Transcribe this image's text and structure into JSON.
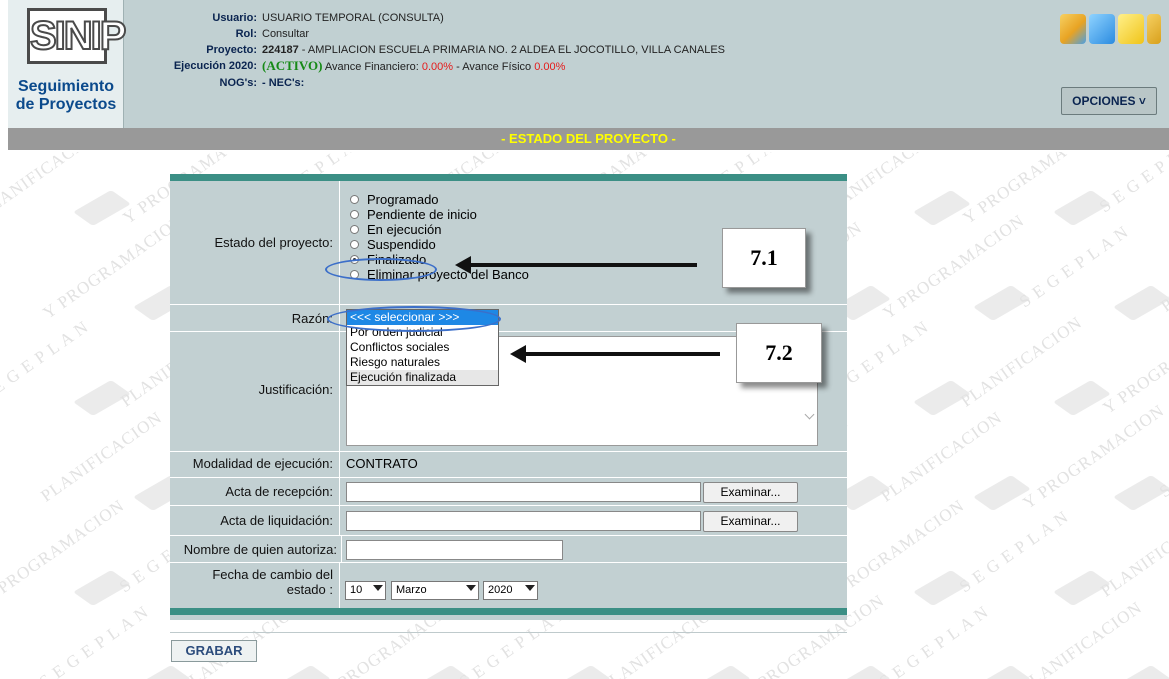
{
  "header": {
    "logo_text": "SINIP",
    "logo_sub_1": "Seguimiento",
    "logo_sub_2": "de Proyectos",
    "usuario_label": "Usuario:",
    "usuario_value": "USUARIO TEMPORAL (CONSULTA)",
    "rol_label": "Rol:",
    "rol_value": "Consultar",
    "proyecto_label": "Proyecto:",
    "proyecto_code": "224187",
    "proyecto_name": " - AMPLIACION ESCUELA PRIMARIA NO. 2 ALDEA EL JOCOTILLO, VILLA CANALES",
    "ejecucion_label": "Ejecución 2020:",
    "ejecucion_status": "(ACTIVO)",
    "avance_fin_label": " Avance Financiero: ",
    "avance_fin_value": "0.00%",
    "avance_fis_label": " - Avance Físico ",
    "avance_fis_value": "0.00%",
    "nog_label": "NOG's:",
    "nog_value": "- NEC's:",
    "opciones_label": "OPCIONES ˅",
    "icons": [
      "cube-icon",
      "report-icon",
      "pencil-icon",
      "door-icon"
    ],
    "icon_colors": [
      "#e8a323",
      "#2b8be0",
      "#f0c419",
      "#d8a01c"
    ]
  },
  "title": "- ESTADO DEL PROYECTO -",
  "form": {
    "estado_label": "Estado del proyecto:",
    "estado_options": [
      "Programado",
      "Pendiente de inicio",
      "En ejecución",
      "Suspendido",
      "Finalizado",
      "Eliminar proyecto del Banco"
    ],
    "estado_selected": "Finalizado",
    "razon_label": "Razón:",
    "razon_selected": "<<< seleccionar >>>",
    "razon_options": [
      "<<< seleccionar >>>",
      "Por orden judicial",
      "Conflictos sociales",
      "Riesgo naturales",
      "Ejecución finalizada"
    ],
    "justificacion_label": "Justificación:",
    "modalidad_label": "Modalidad de ejecución:",
    "modalidad_value": "CONTRATO",
    "acta_recepcion_label": "Acta de recepción:",
    "acta_liquidacion_label": "Acta de liquidación:",
    "examinar_label": "Examinar...",
    "autoriza_label": "Nombre de quien autoriza:",
    "fecha_label_1": "Fecha de cambio del",
    "fecha_label_2": "estado :",
    "fecha_day": "10",
    "fecha_month": "Marzo",
    "fecha_year": "2020"
  },
  "annotations": {
    "callout_1": "7.1",
    "callout_2": "7.2"
  },
  "grabar_label": "GRABAR",
  "watermark": [
    "PLANIFICACION",
    "Y PROGRAMACION",
    "S E G E P L A N"
  ]
}
